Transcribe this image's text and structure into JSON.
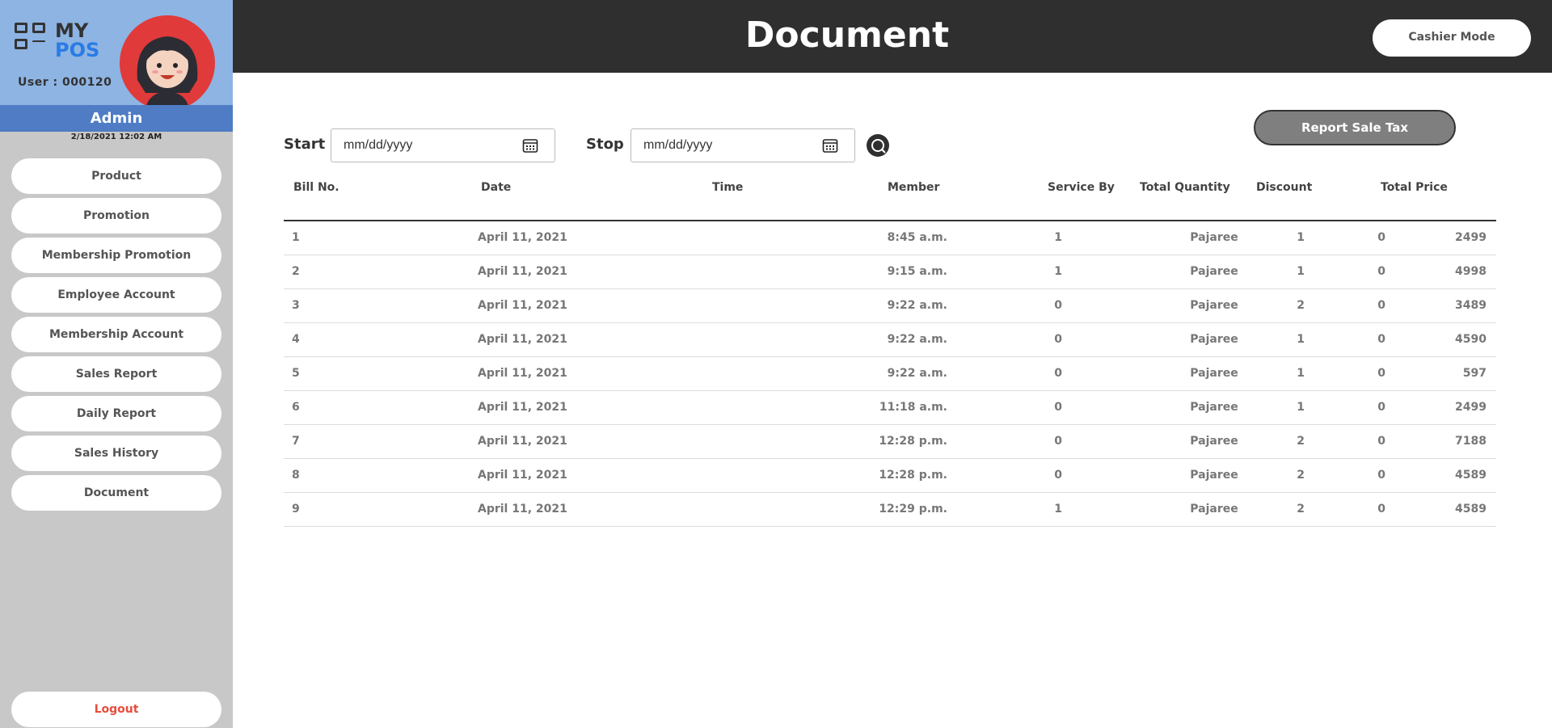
{
  "sidebar": {
    "logo_line1": "MY",
    "logo_line2": "POS",
    "user_label": "User :",
    "user_id": "000120",
    "role": "Admin",
    "datetime": "2/18/2021 12:02 AM",
    "nav": [
      {
        "label": "Product"
      },
      {
        "label": "Promotion"
      },
      {
        "label": "Membership Promotion"
      },
      {
        "label": "Employee Account"
      },
      {
        "label": "Membership Account"
      },
      {
        "label": "Sales Report"
      },
      {
        "label": "Daily Report"
      },
      {
        "label": "Sales History"
      },
      {
        "label": "Document"
      }
    ],
    "logout": "Logout"
  },
  "header": {
    "title": "Document",
    "cashier_mode": "Cashier Mode"
  },
  "filter": {
    "start_label": "Start",
    "stop_label": "Stop",
    "start_placeholder": "mm/dd/yyyy",
    "stop_placeholder": "mm/dd/yyyy",
    "report_button": "Report Sale Tax"
  },
  "table": {
    "headers": [
      "Bill No.",
      "Date",
      "Time",
      "Member",
      "Service By",
      "Total Quantity",
      "Discount",
      "Total Price"
    ],
    "rows": [
      [
        "1",
        "April 11, 2021",
        "8:45 a.m.",
        "1",
        "Pajaree",
        "1",
        "0",
        "2499"
      ],
      [
        "2",
        "April 11, 2021",
        "9:15 a.m.",
        "1",
        "Pajaree",
        "1",
        "0",
        "4998"
      ],
      [
        "3",
        "April 11, 2021",
        "9:22 a.m.",
        "0",
        "Pajaree",
        "2",
        "0",
        "3489"
      ],
      [
        "4",
        "April 11, 2021",
        "9:22 a.m.",
        "0",
        "Pajaree",
        "1",
        "0",
        "4590"
      ],
      [
        "5",
        "April 11, 2021",
        "9:22 a.m.",
        "0",
        "Pajaree",
        "1",
        "0",
        "597"
      ],
      [
        "6",
        "April 11, 2021",
        "11:18 a.m.",
        "0",
        "Pajaree",
        "1",
        "0",
        "2499"
      ],
      [
        "7",
        "April 11, 2021",
        "12:28 p.m.",
        "0",
        "Pajaree",
        "2",
        "0",
        "7188"
      ],
      [
        "8",
        "April 11, 2021",
        "12:28 p.m.",
        "0",
        "Pajaree",
        "2",
        "0",
        "4589"
      ],
      [
        "9",
        "April 11, 2021",
        "12:29 p.m.",
        "1",
        "Pajaree",
        "2",
        "0",
        "4589"
      ]
    ]
  },
  "icons": {
    "calendar": "calendar-icon",
    "search": "search-icon",
    "logo": "grid-logo-icon",
    "avatar": "avatar-icon"
  },
  "colors": {
    "header_bg": "#2f2f2f",
    "sidebar_bg": "#c8c8c8",
    "profile_bg": "#8db4e3",
    "admin_bar": "#4f7cc4",
    "logout_text": "#e74c3c",
    "accent_blue": "#2a7be4"
  }
}
